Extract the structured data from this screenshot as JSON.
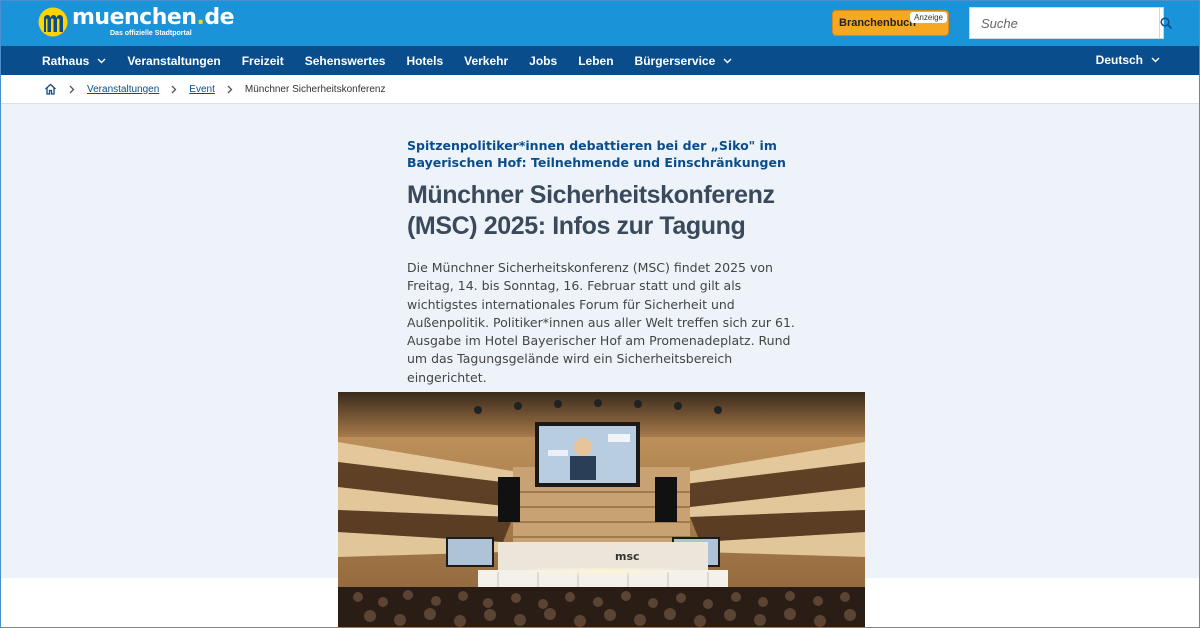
{
  "site": {
    "logo_name_main": "muenchen",
    "logo_name_dot": ".",
    "logo_name_tld": "de",
    "logo_subtitle": "Das offizielle Stadtportal"
  },
  "header": {
    "branchenbuch_label": "Branchenbuch",
    "anzeige_label": "Anzeige",
    "search_placeholder": "Suche"
  },
  "nav": {
    "items": [
      {
        "label": "Rathaus",
        "dropdown": true
      },
      {
        "label": "Veranstaltungen",
        "dropdown": false
      },
      {
        "label": "Freizeit",
        "dropdown": false
      },
      {
        "label": "Sehenswertes",
        "dropdown": false
      },
      {
        "label": "Hotels",
        "dropdown": false
      },
      {
        "label": "Verkehr",
        "dropdown": false
      },
      {
        "label": "Jobs",
        "dropdown": false
      },
      {
        "label": "Leben",
        "dropdown": false
      },
      {
        "label": "Bürgerservice",
        "dropdown": true
      }
    ],
    "language": "Deutsch"
  },
  "breadcrumb": {
    "items": [
      "Veranstaltungen",
      "Event"
    ],
    "current": "Münchner Sicherheitskonferenz"
  },
  "article": {
    "kicker": "Spitzenpolitiker*innen debattieren bei der „Siko\" im Bayerischen Hof: Teilnehmende und Einschränkungen",
    "headline": "Münchner Sicherheitskonferenz (MSC) 2025: Infos zur Tagung",
    "lead": "Die Münchner Sicherheitskonferenz (MSC) findet 2025 von Freitag, 14. bis Sonntag, 16. Februar statt und gilt als wichtigstes internationales Forum für Sicherheit und Außenpolitik. Politiker*innen aus aller Welt treffen sich zur 61. Ausgabe im Hotel Bayerischer Hof am Promenadeplatz. Rund um das Tagungsgelände wird ein Sicherheitsbereich eingerichtet."
  },
  "image": {
    "screen_brand": "msc"
  },
  "colors": {
    "topbar": "#1a93d9",
    "navbar": "#0a4d8c",
    "accent_orange": "#f7a823",
    "logo_yellow": "#ffd400",
    "headline": "#3a4a5c"
  }
}
